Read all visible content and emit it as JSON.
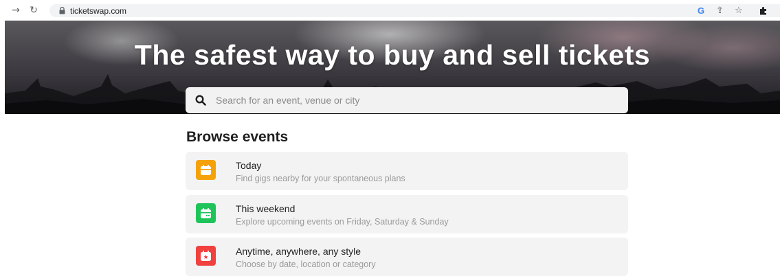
{
  "browser": {
    "url": "ticketswap.com",
    "icons": [
      "forward-icon",
      "reload-icon",
      "lock-icon",
      "google-icon",
      "share-icon",
      "bookmark-star-icon",
      "extensions-icon"
    ]
  },
  "hero": {
    "title": "The safest way to buy and sell tickets",
    "search_placeholder": "Search for an event, venue or city"
  },
  "browse": {
    "heading": "Browse events",
    "items": [
      {
        "title": "Today",
        "subtitle": "Find gigs nearby for your spontaneous plans",
        "color": "#f5a20a",
        "icon": "calendar-icon"
      },
      {
        "title": "This weekend",
        "subtitle": "Explore upcoming events on Friday, Saturday & Sunday",
        "color": "#1ec45a",
        "icon": "calendar-weekend-icon"
      },
      {
        "title": "Anytime, anywhere, any style",
        "subtitle": "Choose by date, location or category",
        "color": "#f0413f",
        "icon": "star-calendar-icon"
      }
    ]
  }
}
